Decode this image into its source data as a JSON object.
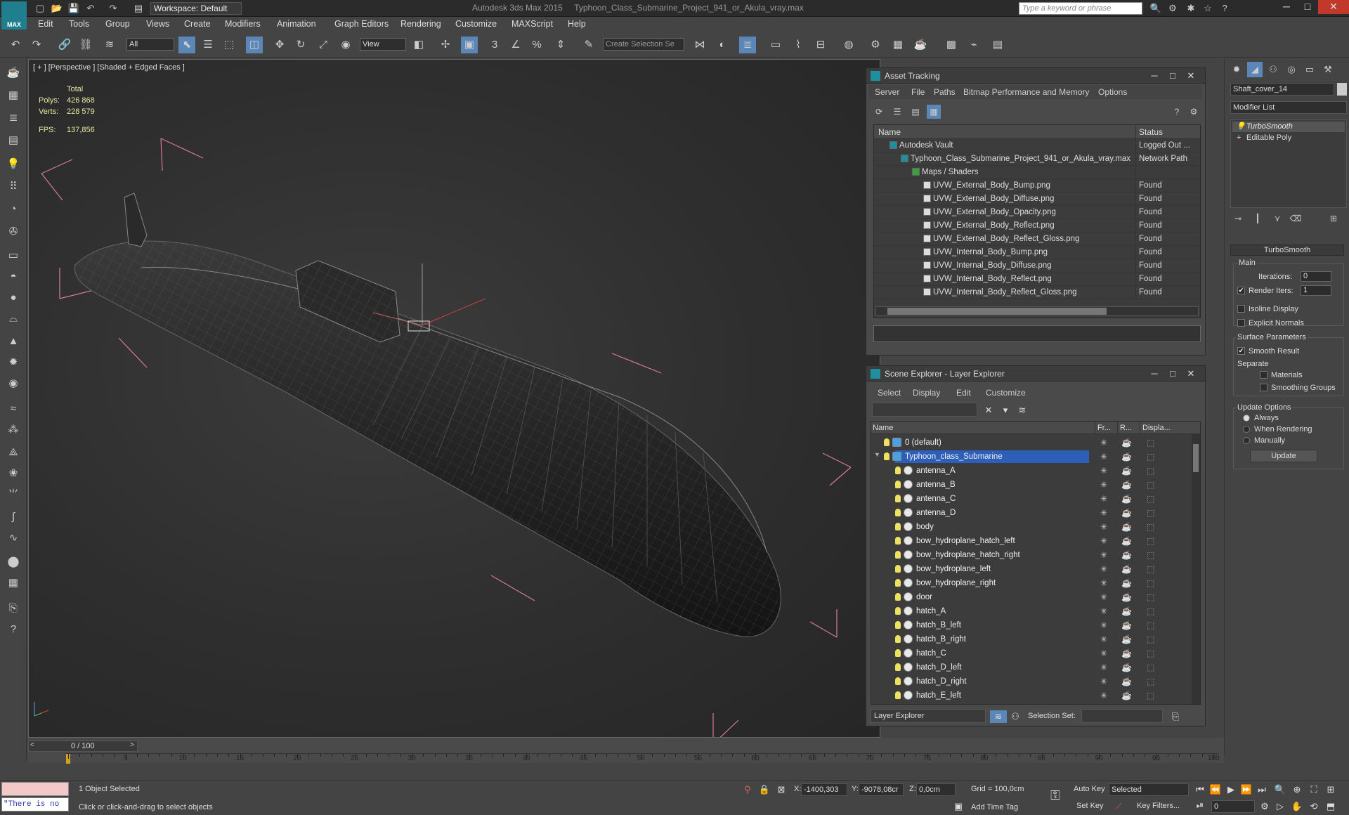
{
  "titlebar": {
    "logo_text": "MAX",
    "workspace": "Workspace: Default",
    "title": "Autodesk 3ds Max 2015     Typhoon_Class_Submarine_Project_941_or_Akula_vray.max",
    "search_placeholder": "Type a keyword or phrase"
  },
  "menu": [
    "Edit",
    "Tools",
    "Group",
    "Views",
    "Create",
    "Modifiers",
    "Animation",
    "Graph Editors",
    "Rendering",
    "Customize",
    "MAXScript",
    "Help"
  ],
  "toolbar": {
    "filter_value": "All",
    "refcoord_value": "View",
    "selection_set_placeholder": "Create Selection Se",
    "snap_labels": [
      "3",
      "%"
    ]
  },
  "viewport": {
    "label": "[ + ] [Perspective ] [Shaded + Edged Faces ]",
    "stats_header": "Total",
    "polys_label": "Polys:",
    "polys_value": "426 868",
    "verts_label": "Verts:",
    "verts_value": "228 579",
    "fps_label": "FPS:",
    "fps_value": "137,856"
  },
  "asset_tracking": {
    "title": "Asset Tracking",
    "menu": [
      "Server",
      "File",
      "Paths",
      "Bitmap Performance and Memory",
      "Options"
    ],
    "col_name": "Name",
    "col_status": "Status",
    "rows": [
      {
        "name": "Autodesk Vault",
        "status": "Logged Out ...",
        "indent": 1
      },
      {
        "name": "Typhoon_Class_Submarine_Project_941_or_Akula_vray.max",
        "status": "Network Path",
        "indent": 2
      },
      {
        "name": "Maps / Shaders",
        "status": "",
        "indent": 3
      },
      {
        "name": "UVW_External_Body_Bump.png",
        "status": "Found",
        "indent": 4
      },
      {
        "name": "UVW_External_Body_Diffuse.png",
        "status": "Found",
        "indent": 4
      },
      {
        "name": "UVW_External_Body_Opacity.png",
        "status": "Found",
        "indent": 4
      },
      {
        "name": "UVW_External_Body_Reflect.png",
        "status": "Found",
        "indent": 4
      },
      {
        "name": "UVW_External_Body_Reflect_Gloss.png",
        "status": "Found",
        "indent": 4
      },
      {
        "name": "UVW_Internal_Body_Bump.png",
        "status": "Found",
        "indent": 4
      },
      {
        "name": "UVW_Internal_Body_Diffuse.png",
        "status": "Found",
        "indent": 4
      },
      {
        "name": "UVW_Internal_Body_Reflect.png",
        "status": "Found",
        "indent": 4
      },
      {
        "name": "UVW_Internal_Body_Reflect_Gloss.png",
        "status": "Found",
        "indent": 4
      }
    ]
  },
  "scene_explorer": {
    "title": "Scene Explorer - Layer Explorer",
    "menu": [
      "Select",
      "Display",
      "Edit",
      "Customize"
    ],
    "col_name": "Name",
    "col_fr": "Fr...",
    "col_r": "R...",
    "col_disp": "Displa...",
    "layers": [
      {
        "name": "0 (default)",
        "level": 0
      },
      {
        "name": "Typhoon_class_Submarine",
        "level": 0,
        "selected": true
      }
    ],
    "objects": [
      "antenna_A",
      "antenna_B",
      "antenna_C",
      "antenna_D",
      "body",
      "bow_hydroplane_hatch_left",
      "bow_hydroplane_hatch_right",
      "bow_hydroplane_left",
      "bow_hydroplane_right",
      "door",
      "hatch_A",
      "hatch_B_left",
      "hatch_B_right",
      "hatch_C",
      "hatch_D_left",
      "hatch_D_right",
      "hatch_E_left"
    ],
    "footer_mode": "Layer Explorer",
    "selection_set_label": "Selection Set:"
  },
  "command_panel": {
    "object_name": "Shaft_cover_14",
    "modifier_list": "Modifier List",
    "stack": [
      "TurboSmooth",
      "Editable Poly"
    ],
    "rollout_title": "TurboSmooth",
    "main_label": "Main",
    "iterations_label": "Iterations:",
    "iterations_value": "0",
    "render_iters_label": "Render Iters:",
    "render_iters_value": "1",
    "isoline_label": "Isoline Display",
    "explicit_label": "Explicit Normals",
    "surface_label": "Surface Parameters",
    "smooth_label": "Smooth Result",
    "separate_label": "Separate",
    "materials_label": "Materials",
    "smoothing_groups_label": "Smoothing Groups",
    "update_options_label": "Update Options",
    "always_label": "Always",
    "when_rendering_label": "When Rendering",
    "manually_label": "Manually",
    "update_button": "Update"
  },
  "timeline": {
    "frame_label": "0 / 100",
    "ticks": [
      "5",
      "10",
      "15",
      "20",
      "25",
      "30",
      "35",
      "40",
      "45",
      "50",
      "55",
      "60",
      "65",
      "70",
      "75",
      "80",
      "85",
      "90",
      "95",
      "100"
    ],
    "progress": 0
  },
  "status": {
    "maxscript_text": "\"There is no",
    "selected_text": "1 Object Selected",
    "prompt_text": "Click or click-and-drag to select objects",
    "x_label": "X:",
    "x_value": "-1400,303",
    "y_label": "Y:",
    "y_value": "-9078,08cr",
    "z_label": "Z:",
    "z_value": "0,0cm",
    "grid_text": "Grid = 100,0cm",
    "add_time_tag": "Add Time Tag",
    "auto_key": "Auto Key",
    "selected_dropdown": "Selected",
    "set_key": "Set Key",
    "key_filters": "Key Filters...",
    "frame_value": "0"
  }
}
